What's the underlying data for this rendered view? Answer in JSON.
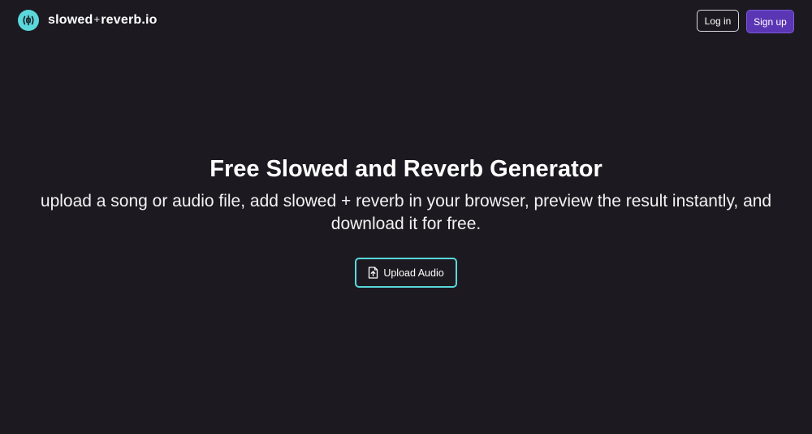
{
  "header": {
    "brand": {
      "name_left": "slowed",
      "name_plus": "+",
      "name_right": "reverb.io",
      "logo_icon": "sound-wave-icon",
      "logo_color": "#5ad8dc"
    },
    "login_label": "Log in",
    "signup_label": "Sign up",
    "signup_color": "#5b36b4"
  },
  "hero": {
    "title": "Free Slowed and Reverb Generator",
    "subtitle": "upload a song or audio file, add slowed + reverb in your browser, preview the result instantly, and download it for free.",
    "upload_label": "Upload Audio",
    "upload_icon": "file-upload-icon",
    "upload_border_color": "#5ad8dc"
  },
  "theme": {
    "background": "#1c1a20"
  }
}
